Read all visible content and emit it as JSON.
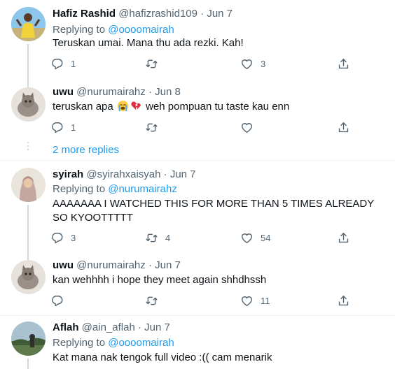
{
  "tweets": [
    {
      "name": "Hafiz Rashid",
      "handle": "@hafizrashid109",
      "sep": "·",
      "date": "Jun 7",
      "replying_label": "Replying to",
      "replying_to": "@oooomairah",
      "text": "Teruskan umai. Mana thu ada rezki. Kah!",
      "replies": "1",
      "retweets": "",
      "likes": "3"
    },
    {
      "name": "uwu",
      "handle": "@nurumairahz",
      "sep": "·",
      "date": "Jun 8",
      "text_before": "teruskan apa",
      "text_after": "weh pompuan tu taste kau enn",
      "emojis": [
        "loudly-crying-face",
        "broken-heart"
      ],
      "replies": "1",
      "retweets": "",
      "likes": ""
    },
    {
      "name": "syirah",
      "handle": "@syirahxaisyah",
      "sep": "·",
      "date": "Jun 7",
      "replying_label": "Replying to",
      "replying_to": "@nurumairahz",
      "text": "AAAAAAA I WATCHED THIS FOR MORE THAN 5 TIMES ALREADY SO KYOOTTTTT",
      "replies": "3",
      "retweets": "4",
      "likes": "54"
    },
    {
      "name": "uwu",
      "handle": "@nurumairahz",
      "sep": "·",
      "date": "Jun 7",
      "text": "kan wehhhh i hope they meet again shhdhssh",
      "replies": "",
      "retweets": "",
      "likes": "11"
    },
    {
      "name": "Aflah",
      "handle": "@ain_aflah",
      "sep": "·",
      "date": "Jun 7",
      "replying_label": "Replying to",
      "replying_to": "@oooomairah",
      "text": "Kat mana nak tengok full video :(( cam menarik"
    }
  ],
  "more_replies": "2 more replies",
  "icons": {
    "reply": "reply-icon",
    "retweet": "retweet-icon",
    "like": "like-icon",
    "share": "share-icon"
  },
  "colors": {
    "link": "#1d9bf0",
    "secondary_text": "#536471",
    "primary_text": "#0f1419",
    "divider": "#eff3f4",
    "thread_line": "#cfd9de"
  }
}
